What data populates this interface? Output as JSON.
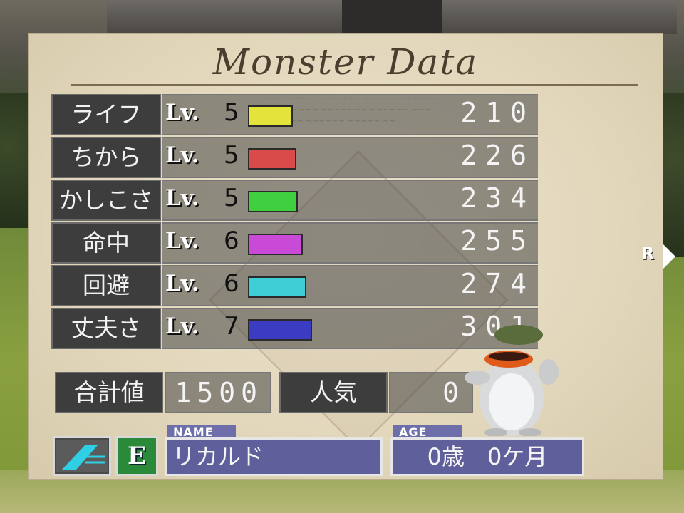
{
  "screen": {
    "title": "Monster Data"
  },
  "stats": [
    {
      "label": "ライフ",
      "lv_prefix": "Lv.",
      "level": "5",
      "value": "210",
      "bar_color": "#e3e33b",
      "bar_fraction": 0.21
    },
    {
      "label": "ちから",
      "lv_prefix": "Lv.",
      "level": "5",
      "value": "226",
      "bar_color": "#d94b4b",
      "bar_fraction": 0.226
    },
    {
      "label": "かしこさ",
      "lv_prefix": "Lv.",
      "level": "5",
      "value": "234",
      "bar_color": "#3fcf3f",
      "bar_fraction": 0.234
    },
    {
      "label": "命中",
      "lv_prefix": "Lv.",
      "level": "6",
      "value": "255",
      "bar_color": "#c84ad6",
      "bar_fraction": 0.255
    },
    {
      "label": "回避",
      "lv_prefix": "Lv.",
      "level": "6",
      "value": "274",
      "bar_color": "#3ecfd6",
      "bar_fraction": 0.274
    },
    {
      "label": "丈夫さ",
      "lv_prefix": "Lv.",
      "level": "7",
      "value": "301",
      "bar_color": "#3c3cc2",
      "bar_fraction": 0.301
    }
  ],
  "totals": {
    "sum_label": "合計値",
    "sum_value": "1500",
    "popularity_label": "人気",
    "popularity_value": "0"
  },
  "profile": {
    "name_tag": "NAME",
    "name": "リカルド",
    "age_tag": "AGE",
    "age": "0歳　0ケ月",
    "type_badge": "E"
  },
  "nav": {
    "right_button": "R"
  }
}
